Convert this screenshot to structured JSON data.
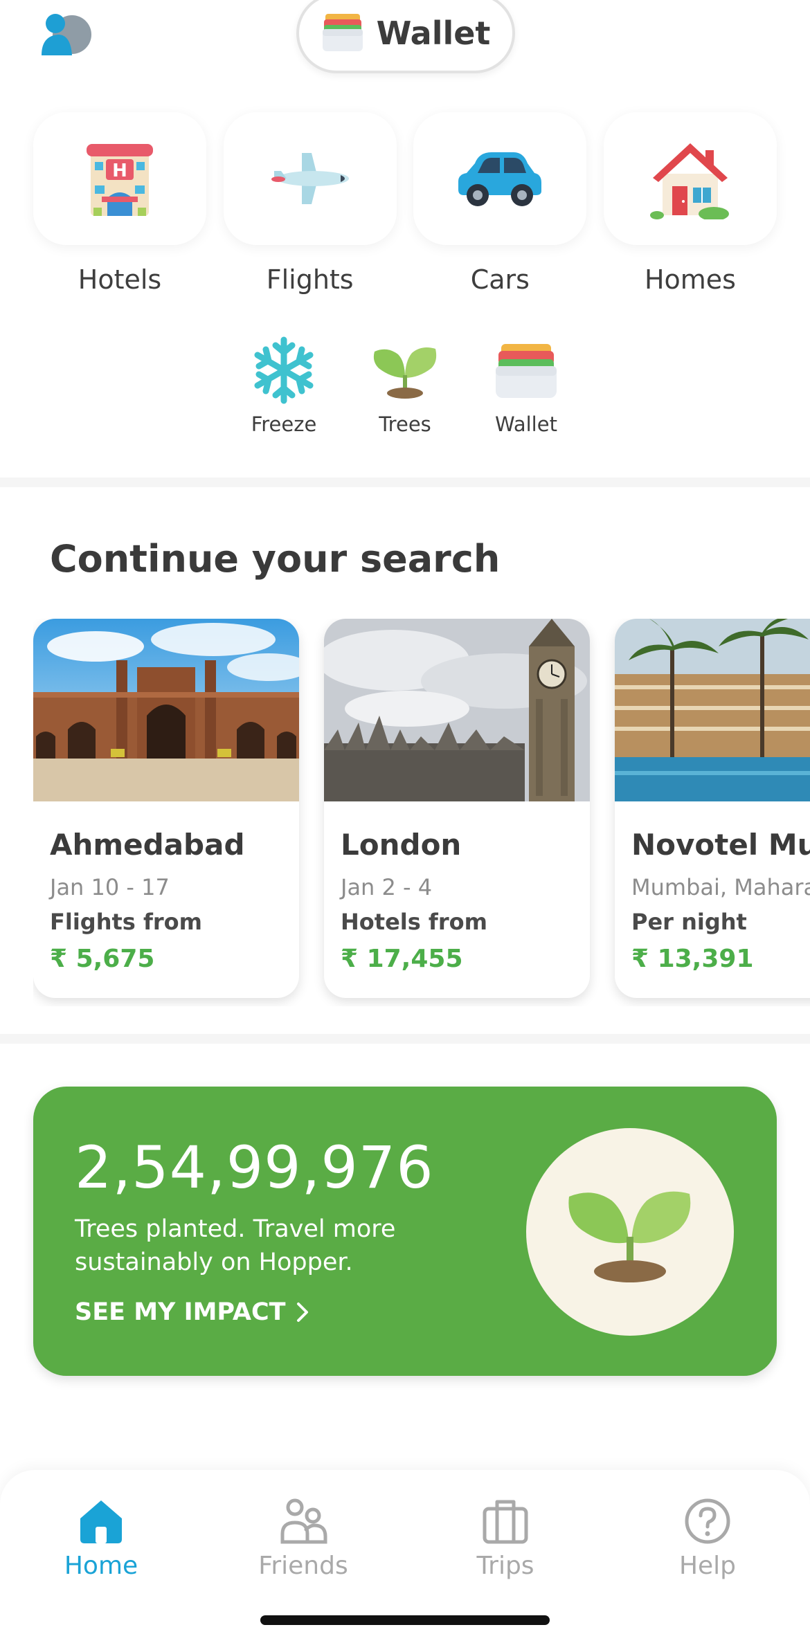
{
  "header": {
    "wallet_label": "Wallet"
  },
  "categories": [
    {
      "label": "Hotels",
      "icon": "hotel-icon"
    },
    {
      "label": "Flights",
      "icon": "airplane-icon"
    },
    {
      "label": "Cars",
      "icon": "car-icon"
    },
    {
      "label": "Homes",
      "icon": "house-icon"
    }
  ],
  "quick_links": [
    {
      "label": "Freeze",
      "icon": "snowflake-icon"
    },
    {
      "label": "Trees",
      "icon": "sprout-icon"
    },
    {
      "label": "Wallet",
      "icon": "wallet-icon"
    }
  ],
  "continue_search": {
    "title": "Continue your search",
    "cards": [
      {
        "title": "Ahmedabad",
        "dates": "Jan 10 -  17",
        "kind": "Flights from",
        "price": "₹ 5,675"
      },
      {
        "title": "London",
        "dates": "Jan 2 -  4",
        "kind": "Hotels from",
        "price": "₹ 17,455"
      },
      {
        "title": "Novotel Mumbai",
        "dates": "Mumbai, Maharashtra",
        "kind": "Per night",
        "price": "₹ 13,391"
      }
    ]
  },
  "impact": {
    "count": "2,54,99,976",
    "description": "Trees planted. Travel more sustainably on Hopper.",
    "cta": "SEE MY IMPACT"
  },
  "nav": [
    {
      "label": "Home",
      "icon": "home-icon",
      "active": true
    },
    {
      "label": "Friends",
      "icon": "friends-icon",
      "active": false
    },
    {
      "label": "Trips",
      "icon": "suitcase-icon",
      "active": false
    },
    {
      "label": "Help",
      "icon": "help-icon",
      "active": false
    }
  ],
  "colors": {
    "accent_blue": "#1aa3d6",
    "price_green": "#4cae49",
    "impact_green": "#5aac45"
  }
}
